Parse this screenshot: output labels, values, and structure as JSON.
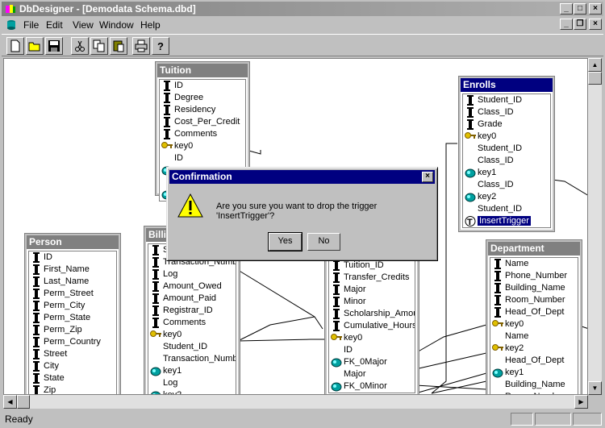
{
  "window": {
    "title": "DbDesigner - [Demodata Schema.dbd]"
  },
  "menu": [
    "File",
    "Edit",
    "View",
    "Window",
    "Help"
  ],
  "toolbar": [
    "new-file-icon",
    "open-folder-icon",
    "save-icon",
    "cut-icon",
    "copy-icon",
    "paste-icon",
    "print-icon",
    "help-icon"
  ],
  "tables": {
    "tuition": {
      "title": "Tuition",
      "rows": [
        {
          "icon": "column",
          "text": "ID"
        },
        {
          "icon": "column",
          "text": "Degree"
        },
        {
          "icon": "column",
          "text": "Residency"
        },
        {
          "icon": "column",
          "text": "Cost_Per_Credit"
        },
        {
          "icon": "column",
          "text": "Comments"
        },
        {
          "icon": "key",
          "text": "key0"
        },
        {
          "icon": "none",
          "text": "ID"
        },
        {
          "icon": "fk",
          "text": ""
        },
        {
          "icon": "none",
          "text": ""
        },
        {
          "icon": "fk",
          "text": ""
        }
      ]
    },
    "enrolls": {
      "title": "Enrolls",
      "rows": [
        {
          "icon": "column",
          "text": "Student_ID"
        },
        {
          "icon": "column",
          "text": "Class_ID"
        },
        {
          "icon": "column",
          "text": "Grade"
        },
        {
          "icon": "key",
          "text": "key0"
        },
        {
          "icon": "none",
          "text": "Student_ID"
        },
        {
          "icon": "none",
          "text": "Class_ID"
        },
        {
          "icon": "fk",
          "text": "key1"
        },
        {
          "icon": "none",
          "text": "Class_ID"
        },
        {
          "icon": "fk",
          "text": "key2"
        },
        {
          "icon": "none",
          "text": "Student_ID"
        },
        {
          "icon": "trigger",
          "text": "InsertTrigger",
          "selected": true
        }
      ]
    },
    "person": {
      "title": "Person",
      "rows": [
        {
          "icon": "column",
          "text": "ID"
        },
        {
          "icon": "column",
          "text": "First_Name"
        },
        {
          "icon": "column",
          "text": "Last_Name"
        },
        {
          "icon": "column",
          "text": "Perm_Street"
        },
        {
          "icon": "column",
          "text": "Perm_City"
        },
        {
          "icon": "column",
          "text": "Perm_State"
        },
        {
          "icon": "column",
          "text": "Perm_Zip"
        },
        {
          "icon": "column",
          "text": "Perm_Country"
        },
        {
          "icon": "column",
          "text": "Street"
        },
        {
          "icon": "column",
          "text": "City"
        },
        {
          "icon": "column",
          "text": "State"
        },
        {
          "icon": "column",
          "text": "Zip"
        }
      ]
    },
    "billing": {
      "title": "Billi",
      "rows": [
        {
          "icon": "column",
          "text": "S"
        },
        {
          "icon": "column",
          "text": "Transaction_Numb"
        },
        {
          "icon": "column",
          "text": "Log"
        },
        {
          "icon": "column",
          "text": "Amount_Owed"
        },
        {
          "icon": "column",
          "text": "Amount_Paid"
        },
        {
          "icon": "column",
          "text": "Registrar_ID"
        },
        {
          "icon": "column",
          "text": "Comments"
        },
        {
          "icon": "key",
          "text": "key0"
        },
        {
          "icon": "none",
          "text": "Student_ID"
        },
        {
          "icon": "none",
          "text": "Transaction_Numb"
        },
        {
          "icon": "fk",
          "text": "key1"
        },
        {
          "icon": "none",
          "text": "Log"
        },
        {
          "icon": "fk",
          "text": "key2"
        }
      ]
    },
    "student": {
      "title": "",
      "rows": [
        {
          "icon": "column",
          "text": "Tuition_ID"
        },
        {
          "icon": "column",
          "text": "Transfer_Credits"
        },
        {
          "icon": "column",
          "text": "Major"
        },
        {
          "icon": "column",
          "text": "Minor"
        },
        {
          "icon": "column",
          "text": "Scholarship_Amou"
        },
        {
          "icon": "column",
          "text": "Cumulative_Hours"
        },
        {
          "icon": "key",
          "text": "key0"
        },
        {
          "icon": "none",
          "text": "ID"
        },
        {
          "icon": "fk",
          "text": "FK_0Major"
        },
        {
          "icon": "none",
          "text": "Major"
        },
        {
          "icon": "fk",
          "text": "FK_0Minor"
        }
      ]
    },
    "department": {
      "title": "Department",
      "rows": [
        {
          "icon": "column",
          "text": "Name"
        },
        {
          "icon": "column",
          "text": "Phone_Number"
        },
        {
          "icon": "column",
          "text": "Building_Name"
        },
        {
          "icon": "column",
          "text": "Room_Number"
        },
        {
          "icon": "column",
          "text": "Head_Of_Dept"
        },
        {
          "icon": "key",
          "text": "key0"
        },
        {
          "icon": "none",
          "text": "Name"
        },
        {
          "icon": "key",
          "text": "key2"
        },
        {
          "icon": "none",
          "text": "Head_Of_Dept"
        },
        {
          "icon": "fk",
          "text": "key1"
        },
        {
          "icon": "none",
          "text": "Building_Name"
        },
        {
          "icon": "none",
          "text": "Room_Number"
        }
      ]
    }
  },
  "dialog": {
    "title": "Confirmation",
    "message": "Are you sure you want to drop the trigger 'InsertTrigger'?",
    "yes": "Yes",
    "no": "No"
  },
  "status": {
    "text": "Ready"
  },
  "colors": {
    "active_title": "#000080",
    "inactive_title": "#808080",
    "face": "#c0c0c0"
  }
}
